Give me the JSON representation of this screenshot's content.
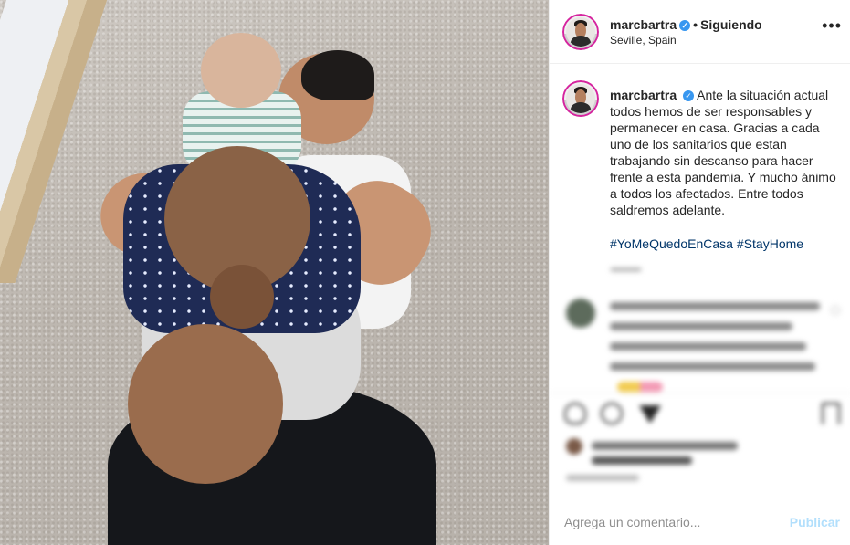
{
  "header": {
    "username": "marcbartra",
    "verified_icon": "verified-badge-icon",
    "separator": "•",
    "follow_status": "Siguiendo",
    "location": "Seville, Spain",
    "more_icon": "•••"
  },
  "caption": {
    "username": "marcbartra",
    "text": "Ante la situación actual todos hemos de ser responsables y permanecer en casa. Gracias a cada uno de los sanitarios que estan trabajando sin descanso para hacer frente a esta pandemia. Y mucho ánimo a todos los afectados. Entre todos saldremos adelante.",
    "hashtags": [
      "#YoMeQuedoEnCasa",
      "#StayHome"
    ]
  },
  "comment_box": {
    "placeholder": "Agrega un comentario...",
    "publish_label": "Publicar"
  },
  "icons": {
    "like": "heart-icon",
    "comment": "comment-bubble-icon",
    "share": "paper-plane-icon",
    "save": "bookmark-icon"
  },
  "colors": {
    "accent_link": "#003569",
    "verified": "#3897f0",
    "publish_disabled": "#b2dffc",
    "story_ring": "#d6249f"
  }
}
